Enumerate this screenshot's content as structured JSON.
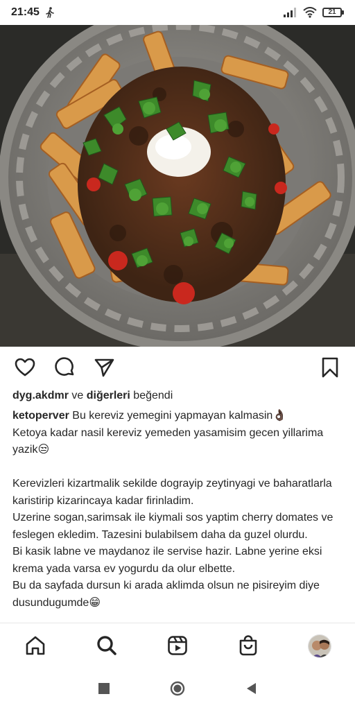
{
  "status_bar": {
    "time": "21:45",
    "battery": "21",
    "icons": [
      "walking-icon",
      "signal-icon",
      "wifi-icon",
      "battery-icon"
    ]
  },
  "post": {
    "image_alt": "food-photo",
    "actions": {
      "like": "heart-icon",
      "comment": "comment-icon",
      "share": "send-icon",
      "save": "bookmark-icon"
    },
    "likes": {
      "user": "dyg.akdmr",
      "connector": " ve ",
      "others": "diğerleri",
      "suffix": " beğendi"
    },
    "caption": {
      "username": "ketoperver",
      "text": " Bu kereviz yemegini yapmayan kalmasin👌🏿\nKetoya kadar nasil kereviz yemeden yasamisim gecen yillarima yazik😒\n\nKerevizleri kizartmalik sekilde dograyip zeytinyagi ve baharatlarla karistirip kizarincaya kadar firinladim.\nUzerine sogan,sarimsak ile kiymali sos yaptim cherry domates ve feslegen ekledim. Tazesini bulabilsem daha da guzel olurdu.\nBi kasik labne ve maydanoz ile servise hazir. Labne yerine eksi krema yada varsa ev yogurdu da olur elbette.\nBu da sayfada dursun ki arada aklimda olsun ne pisireyim diye dusundugumde😁"
    }
  },
  "bottom_nav": [
    "home-icon",
    "search-icon",
    "reels-icon",
    "shop-icon",
    "profile-avatar"
  ],
  "system_nav": [
    "recents-square-icon",
    "home-circle-icon",
    "back-triangle-icon"
  ],
  "colors": {
    "text": "#262626",
    "icon": "#262626",
    "plate": "#8c8a86"
  }
}
